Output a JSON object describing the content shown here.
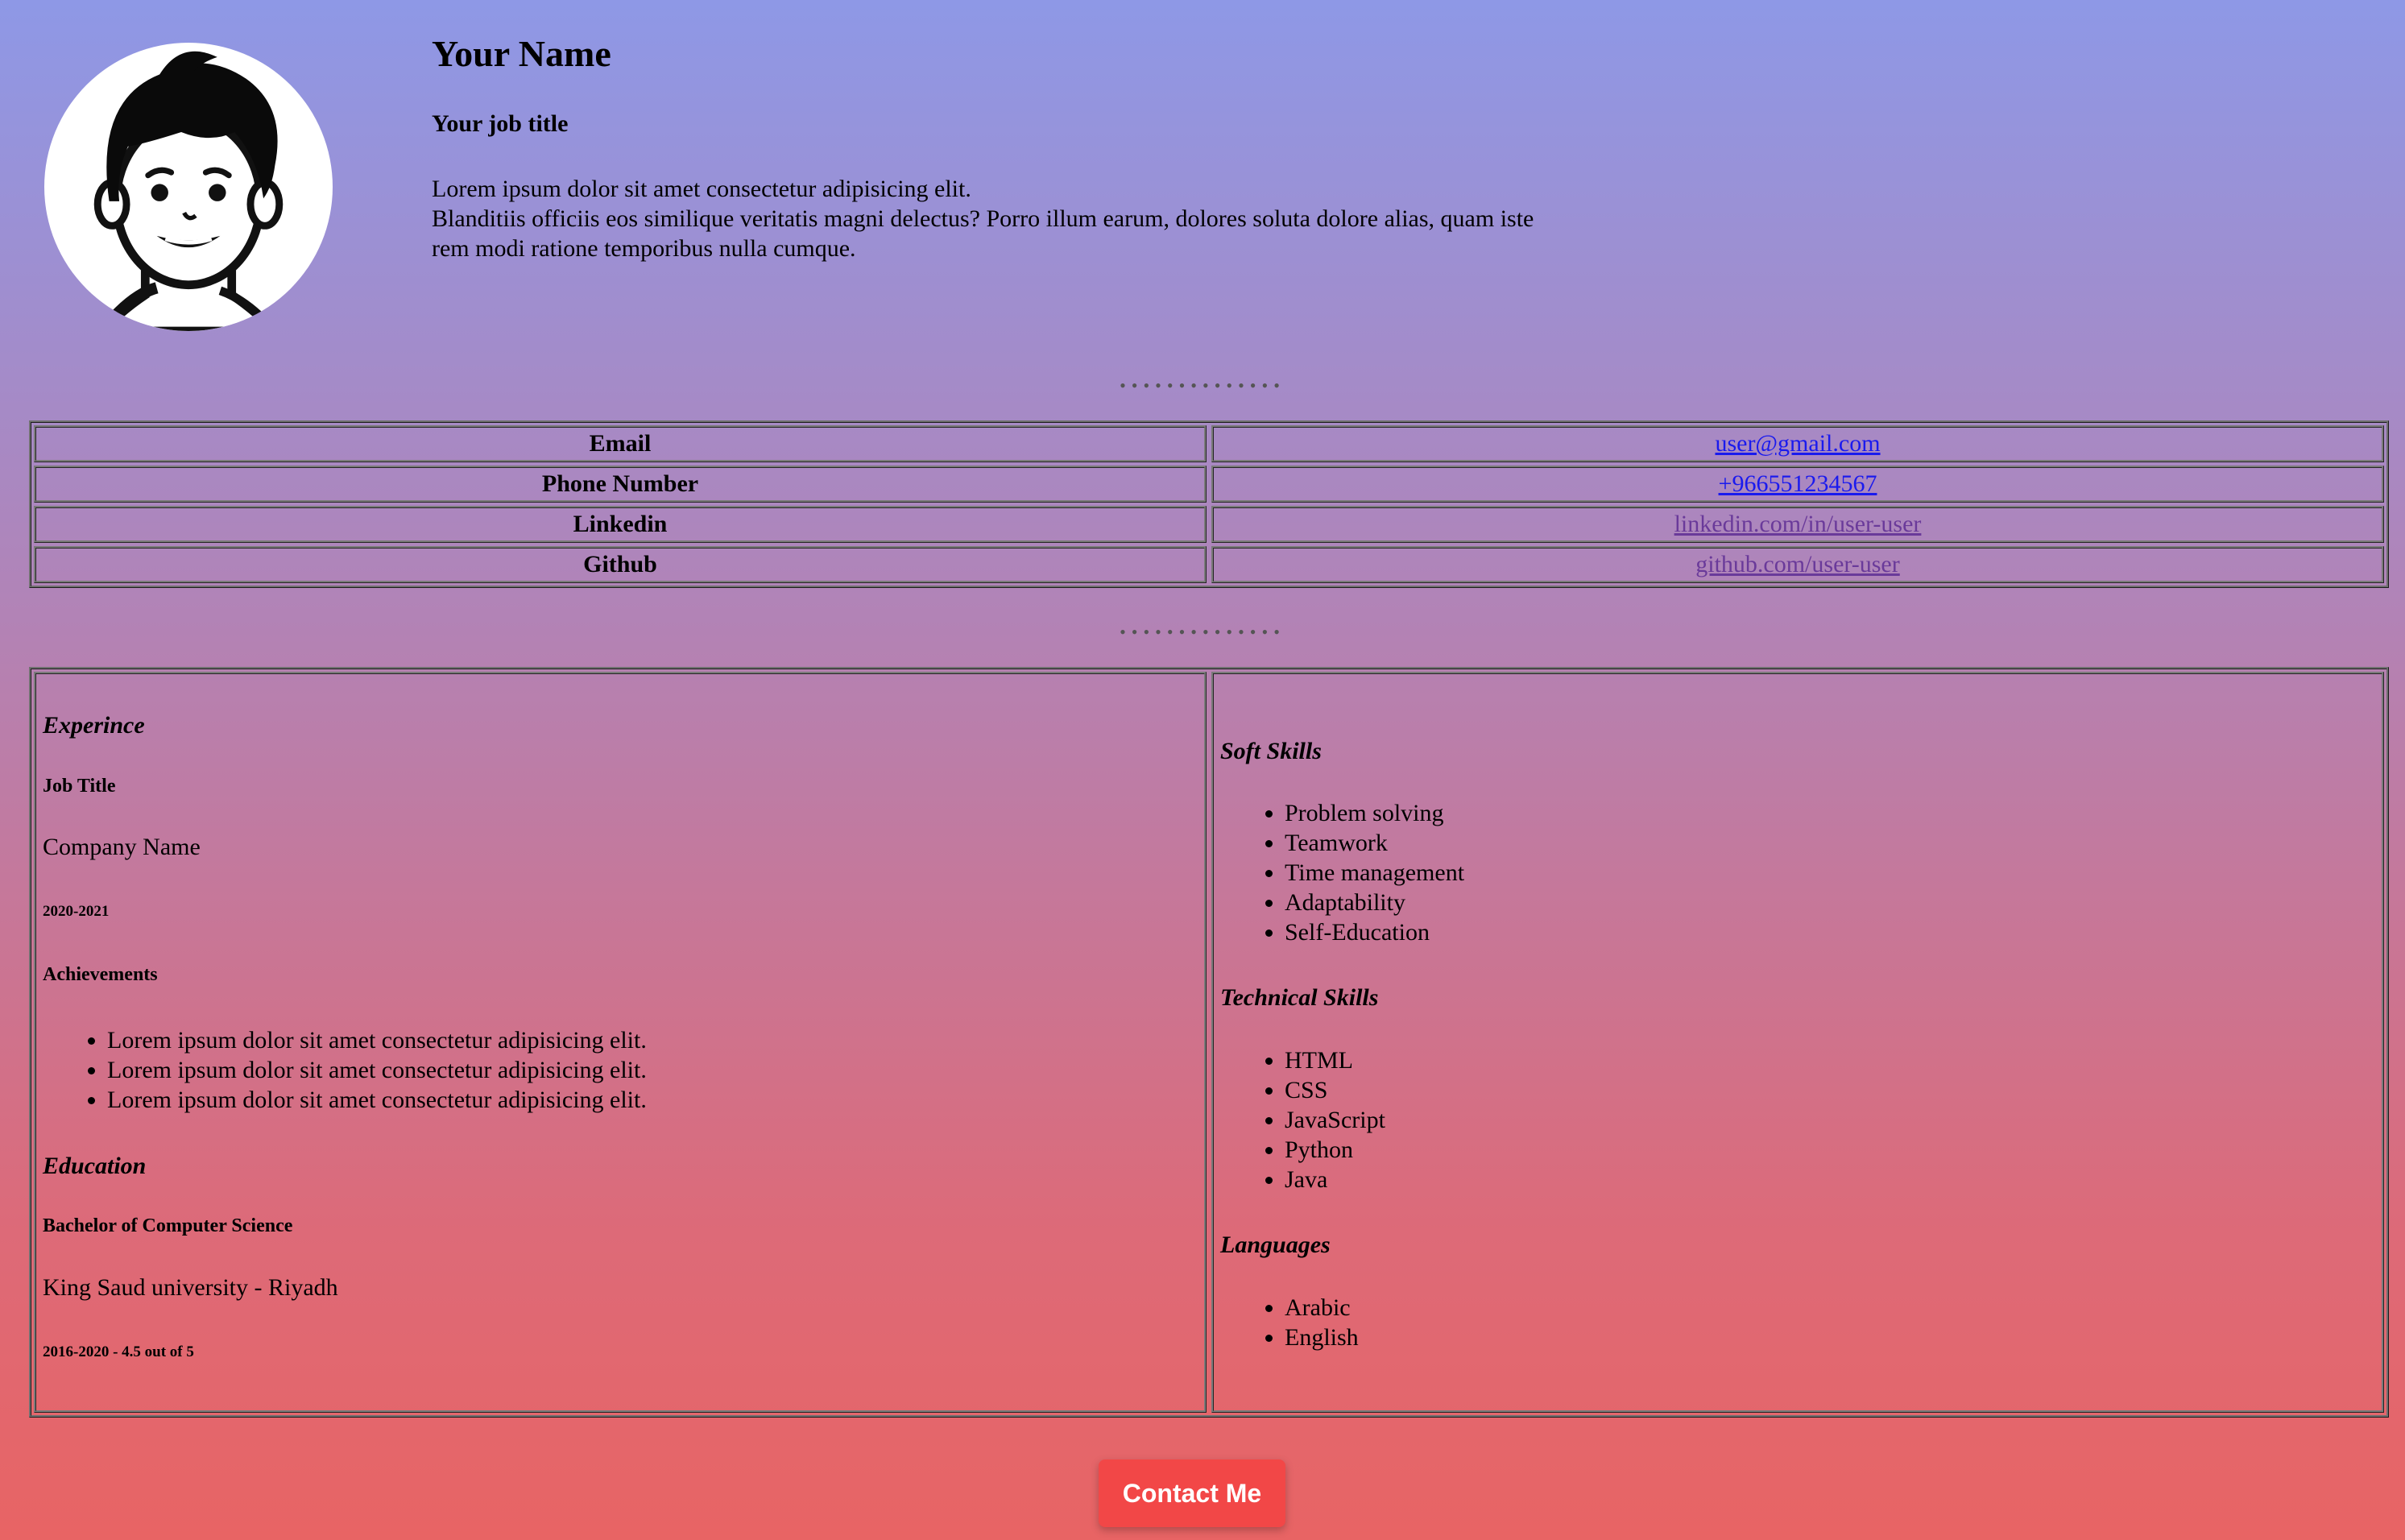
{
  "profile": {
    "name": "Your Name",
    "job_title": "Your job title",
    "bio_line1": "Lorem ipsum dolor sit amet consectetur adipisicing elit.",
    "bio_line2": "Blanditiis officiis eos similique veritatis magni delectus? Porro illum earum, dolores soluta dolore alias, quam iste",
    "bio_line3": "rem modi ratione temporibus nulla cumque.",
    "avatar_icon": "cartoon-person-avatar"
  },
  "separator": "••••••••••••••",
  "contact": {
    "rows": [
      {
        "label": "Email",
        "value": "user@gmail.com"
      },
      {
        "label": "Phone Number",
        "value": "+966551234567"
      },
      {
        "label": "Linkedin",
        "value": "linkedin.com/in/user-user"
      },
      {
        "label": "Github",
        "value": "github.com/user-user"
      }
    ]
  },
  "experience": {
    "heading": "Experince",
    "job_title": "Job Title",
    "company": "Company Name",
    "years": "2020-2021",
    "achievements_heading": "Achievements",
    "achievements": [
      "Lorem ipsum dolor sit amet consectetur adipisicing elit.",
      "Lorem ipsum dolor sit amet consectetur adipisicing elit.",
      "Lorem ipsum dolor sit amet consectetur adipisicing elit."
    ]
  },
  "education": {
    "heading": "Education",
    "degree": "Bachelor of Computer Science",
    "school": "King Saud university - Riyadh",
    "details": "2016-2020 - 4.5 out of 5"
  },
  "skills": {
    "soft_heading": "Soft Skills",
    "soft": [
      "Problem solving",
      "Teamwork",
      "Time management",
      "Adaptability",
      "Self-Education"
    ],
    "technical_heading": "Technical Skills",
    "technical": [
      "HTML",
      "CSS",
      "JavaScript",
      "Python",
      "Java"
    ],
    "languages_heading": "Languages",
    "languages": [
      "Arabic",
      "English"
    ]
  },
  "contact_button": "Contact Me",
  "colors": {
    "gradient_top": "#8e98e6",
    "gradient_bottom": "#e86464",
    "button": "#f24747",
    "link": "#1a1aee",
    "visited_link": "#6a3a9a"
  }
}
